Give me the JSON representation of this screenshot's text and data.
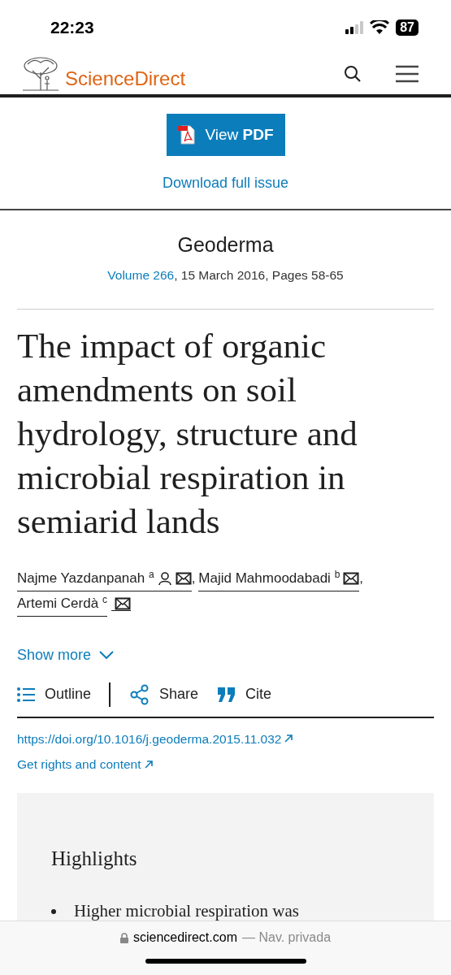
{
  "status_bar": {
    "time": "22:23",
    "battery": "87"
  },
  "header": {
    "logo": "ScienceDirect"
  },
  "pdf": {
    "button": "View **PDF**",
    "download": "Download full issue"
  },
  "journal": {
    "name": "Geoderma",
    "volume_link": "Volume 266",
    "details": ", 15 March 2016, Pages 58-65"
  },
  "title": "The impact of organic amendments on soil hydrology, structure and microbial respiration in semiarid lands",
  "authors": [
    {
      "name": "Najme Yazdanpanah",
      "affiliation": "a",
      "person_icon": true,
      "separator": ","
    },
    {
      "name": "Majid Mahmoodabadi",
      "affiliation": "b",
      "person_icon": false,
      "separator": ","
    },
    {
      "name": "Artemi Cerdà",
      "affiliation": "c",
      "person_icon": false
    }
  ],
  "show_more": "Show more",
  "actions": [
    {
      "kind": "outline",
      "label": "Outline"
    },
    {
      "kind": "share",
      "label": "Share"
    },
    {
      "kind": "cite",
      "label": "Cite"
    }
  ],
  "links": [
    "https://doi.org/10.1016/j.geoderma.2015.11.032",
    "Get rights and content"
  ],
  "highlights": {
    "heading": "Highlights",
    "items": [
      "Higher microbial respiration was"
    ]
  },
  "browser_bar": {
    "domain": "sciencedirect.com",
    "mode": "— Nav. privada"
  }
}
